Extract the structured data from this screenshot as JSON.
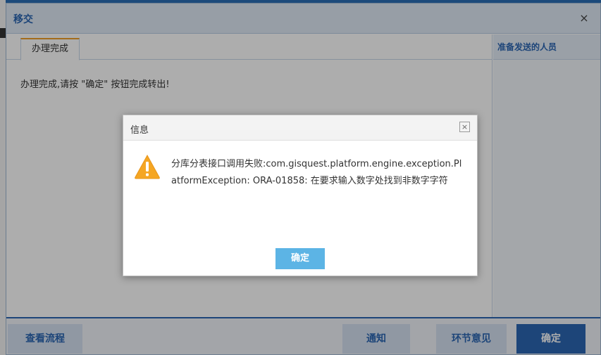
{
  "dialog": {
    "title": "移交",
    "close_glyph": "×",
    "tab_label": "办理完成",
    "message": "办理完成,请按 \"确定\" 按钮完成转出!",
    "right_panel_title": "准备发送的人员"
  },
  "footer": {
    "view_flow": "查看流程",
    "notify": "通知",
    "step_opinion": "环节意见",
    "confirm": "确定"
  },
  "info_box": {
    "title": "信息",
    "close_glyph": "×",
    "message": "分库分表接口调用失败:com.gisquest.platform.engine.exception.PlatformException: ORA-01858: 在要求输入数字处找到非数字字符",
    "confirm": "确定",
    "icon": "warning-icon"
  },
  "colors": {
    "accent": "#2b66b3",
    "header_bg": "#dfe9f5",
    "tab_highlight": "#f0a028",
    "warning": "#f5a623",
    "info_button": "#5cb4e5"
  }
}
